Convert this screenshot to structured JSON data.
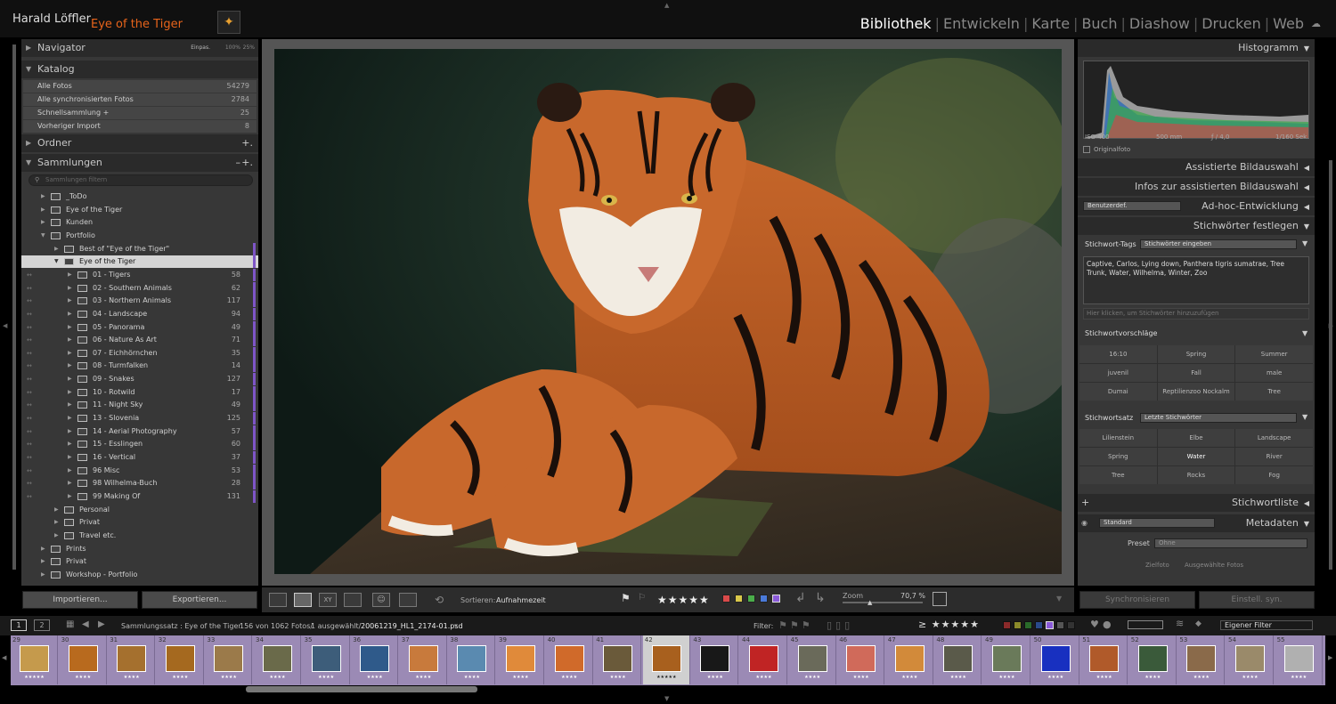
{
  "identity": {
    "name": "Harald Löffler",
    "catalog": "Eye of the Tiger"
  },
  "modules": [
    "Bibliothek",
    "Entwickeln",
    "Karte",
    "Buch",
    "Diashow",
    "Drucken",
    "Web"
  ],
  "modules_active": "Bibliothek",
  "navigator": {
    "title": "Navigator",
    "zoom_options": [
      "Einpas.",
      "100%",
      "25%"
    ]
  },
  "catalog": {
    "title": "Katalog",
    "rows": [
      {
        "label": "Alle Fotos",
        "count": "54279"
      },
      {
        "label": "Alle synchronisierten Fotos",
        "count": "2784"
      },
      {
        "label": "Schnellsammlung  +",
        "count": "25"
      },
      {
        "label": "Vorheriger Import",
        "count": "8"
      }
    ]
  },
  "folders": {
    "title": "Ordner"
  },
  "collections": {
    "title": "Sammlungen",
    "filter_placeholder": "Sammlungen filtern",
    "items": [
      {
        "label": "_ToDo",
        "level": 0,
        "count": ""
      },
      {
        "label": "Eye of the Tiger",
        "level": 0,
        "count": ""
      },
      {
        "label": "Kunden",
        "level": 0,
        "count": ""
      },
      {
        "label": "Portfolio",
        "level": 0,
        "count": "",
        "open": true
      },
      {
        "label": "Best of \"Eye of the Tiger\"",
        "level": 1,
        "count": ""
      },
      {
        "label": "Eye of the Tiger",
        "level": 1,
        "count": "",
        "open": true,
        "selected": true
      },
      {
        "label": "01 - Tigers",
        "level": 2,
        "count": "58"
      },
      {
        "label": "02 - Southern Animals",
        "level": 2,
        "count": "62"
      },
      {
        "label": "03 - Northern Animals",
        "level": 2,
        "count": "117"
      },
      {
        "label": "04 - Landscape",
        "level": 2,
        "count": "94"
      },
      {
        "label": "05 - Panorama",
        "level": 2,
        "count": "49"
      },
      {
        "label": "06 - Nature As Art",
        "level": 2,
        "count": "71"
      },
      {
        "label": "07 - Eichhörnchen",
        "level": 2,
        "count": "35"
      },
      {
        "label": "08 - Turmfalken",
        "level": 2,
        "count": "14"
      },
      {
        "label": "09 - Snakes",
        "level": 2,
        "count": "127"
      },
      {
        "label": "10 - Rotwild",
        "level": 2,
        "count": "17"
      },
      {
        "label": "11 - Night Sky",
        "level": 2,
        "count": "49"
      },
      {
        "label": "13 - Slovenia",
        "level": 2,
        "count": "125"
      },
      {
        "label": "14 - Aerial Photography",
        "level": 2,
        "count": "57"
      },
      {
        "label": "15 - Esslingen",
        "level": 2,
        "count": "60"
      },
      {
        "label": "16 - Vertical",
        "level": 2,
        "count": "37"
      },
      {
        "label": "96 Misc",
        "level": 2,
        "count": "53"
      },
      {
        "label": "98 Wilhelma-Buch",
        "level": 2,
        "count": "28"
      },
      {
        "label": "99 Making Of",
        "level": 2,
        "count": "131"
      },
      {
        "label": "Personal",
        "level": 1,
        "count": ""
      },
      {
        "label": "Privat",
        "level": 1,
        "count": ""
      },
      {
        "label": "Travel etc.",
        "level": 1,
        "count": ""
      },
      {
        "label": "Prints",
        "level": 0,
        "count": ""
      },
      {
        "label": "Privat",
        "level": 0,
        "count": ""
      },
      {
        "label": "Workshop - Portfolio",
        "level": 0,
        "count": ""
      }
    ]
  },
  "left_buttons": {
    "import": "Importieren...",
    "export": "Exportieren..."
  },
  "histogram": {
    "title": "Histogramm",
    "iso": "ISO 400",
    "focal": "500 mm",
    "aperture": "ƒ / 4,0",
    "shutter": "1/160 Sek.",
    "original": "Originalfoto"
  },
  "right_sections": {
    "assisted": "Assistierte Bildauswahl",
    "assisted_info": "Infos zur assistierten Bildauswahl",
    "quick_develop": "Ad-hoc-Entwicklung",
    "quick_develop_preset": "Benutzerdef.",
    "keywording": "Stichwörter festlegen",
    "keyword_list": "Stichwortliste",
    "metadata": "Metadaten"
  },
  "keywording": {
    "tags_label": "Stichwort-Tags",
    "tags_select": "Stichwörter eingeben",
    "tags_text": "Captive, Carlos, Lying down, Panthera tigris sumatrae, Tree Trunk, Water, Wilhelma, Winter, Zoo",
    "add_placeholder": "Hier klicken, um Stichwörter hinzuzufügen",
    "suggestions_title": "Stichwortvorschläge",
    "suggestions": [
      "16:10",
      "Spring",
      "Summer",
      "juvenil",
      "Fall",
      "male",
      "Dumai",
      "Reptilienzoo Nockalm",
      "Tree"
    ],
    "set_label": "Stichwortsatz",
    "set_select": "Letzte Stichwörter",
    "set_items": [
      "Lilienstein",
      "Elbe",
      "Landscape",
      "Spring",
      "Water",
      "River",
      "Tree",
      "Rocks",
      "Fog"
    ]
  },
  "metadata": {
    "mode": "Standard",
    "preset_label": "Preset",
    "preset_value": "Ohne",
    "target_photo": "Zielfoto",
    "selected_photos": "Ausgewählte Fotos"
  },
  "right_buttons": {
    "sync": "Synchronisieren",
    "settings": "Einstell. syn."
  },
  "toolbar": {
    "sort_label": "Sortieren:",
    "sort_value": "Aufnahmezeit",
    "stars": "★★★★★",
    "zoom_label": "Zoom",
    "zoom_value": "70,7 %"
  },
  "filmbar": {
    "pages": [
      "1",
      "2"
    ],
    "source": "Sammlungssatz : Eye of the Tiger",
    "counts": "156 von 1062 Fotos/",
    "selected": "1 ausgewählt/",
    "filename": "20061219_HL1_2174-01.psd",
    "filter_label": "Filter:",
    "custom_filter": "Eigener Filter"
  },
  "filmstrip": [
    {
      "n": "29",
      "stars": "★★★★★",
      "color": "#c59a4c"
    },
    {
      "n": "30",
      "stars": "★★★★",
      "color": "#b86a1e"
    },
    {
      "n": "31",
      "stars": "★★★★",
      "color": "#a5702e"
    },
    {
      "n": "32",
      "stars": "★★★★",
      "color": "#a5691f"
    },
    {
      "n": "33",
      "stars": "★★★★",
      "color": "#9b7a4a"
    },
    {
      "n": "34",
      "stars": "★★★★",
      "color": "#6a6a4a"
    },
    {
      "n": "35",
      "stars": "★★★★",
      "color": "#3d5d7a"
    },
    {
      "n": "36",
      "stars": "★★★★",
      "color": "#2f5a8a"
    },
    {
      "n": "37",
      "stars": "★★★★",
      "color": "#c87a3c"
    },
    {
      "n": "38",
      "stars": "★★★★",
      "color": "#5a8ab0"
    },
    {
      "n": "39",
      "stars": "★★★★",
      "color": "#e08a3a"
    },
    {
      "n": "40",
      "stars": "★★★★",
      "color": "#d06a2a"
    },
    {
      "n": "41",
      "stars": "★★★★",
      "color": "#6a5a3a"
    },
    {
      "n": "42",
      "stars": "★★★★★",
      "color": "#a8601e",
      "selected": true
    },
    {
      "n": "43",
      "stars": "★★★★",
      "color": "#181818"
    },
    {
      "n": "44",
      "stars": "★★★★",
      "color": "#c02424"
    },
    {
      "n": "45",
      "stars": "★★★★",
      "color": "#6a6a5a"
    },
    {
      "n": "46",
      "stars": "★★★★",
      "color": "#d06a5a"
    },
    {
      "n": "47",
      "stars": "★★★★",
      "color": "#d28a3a"
    },
    {
      "n": "48",
      "stars": "★★★★",
      "color": "#5a5a4a"
    },
    {
      "n": "49",
      "stars": "★★★★",
      "color": "#6a7a5a"
    },
    {
      "n": "50",
      "stars": "★★★★",
      "color": "#1830c0"
    },
    {
      "n": "51",
      "stars": "★★★★",
      "color": "#b05a2a"
    },
    {
      "n": "52",
      "stars": "★★★★",
      "color": "#3a5a3a"
    },
    {
      "n": "53",
      "stars": "★★★★",
      "color": "#8a6a4a"
    },
    {
      "n": "54",
      "stars": "★★★★",
      "color": "#9a8a6a"
    },
    {
      "n": "55",
      "stars": "★★★★",
      "color": "#b0b0b0"
    }
  ]
}
